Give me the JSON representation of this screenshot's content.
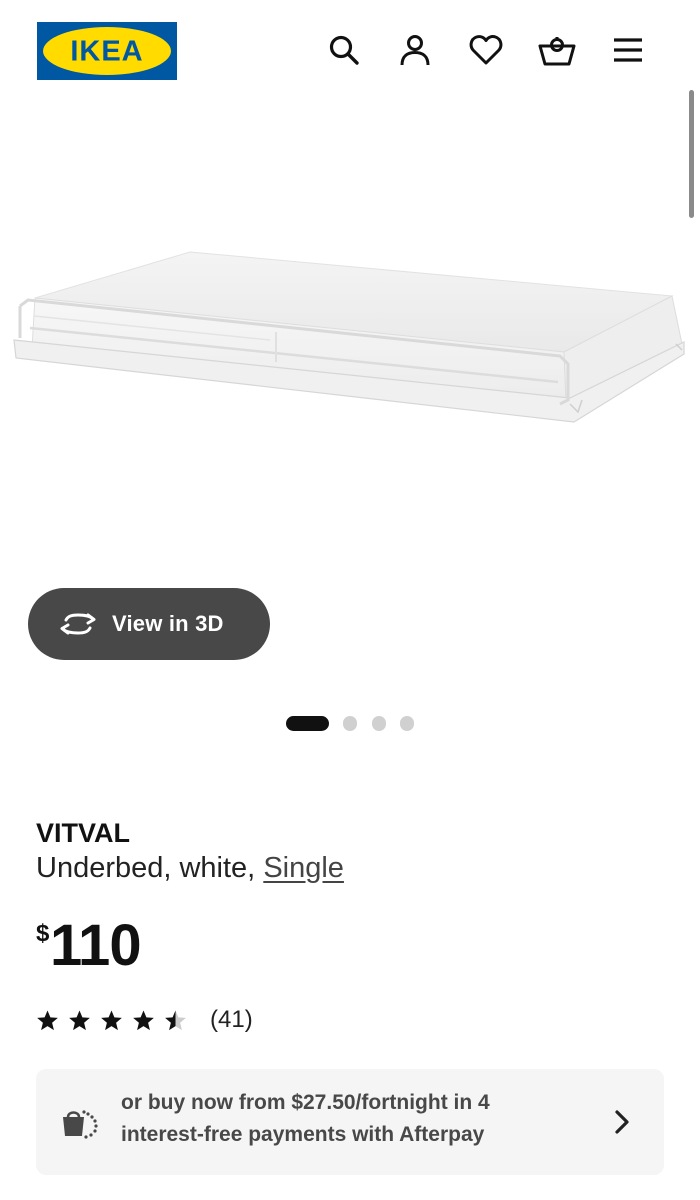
{
  "header": {
    "logo_text": "IKEA",
    "icons": [
      "search-icon",
      "account-icon",
      "heart-icon",
      "basket-icon",
      "menu-icon"
    ]
  },
  "gallery": {
    "view3d_label": "View in 3D",
    "active_slide": 1,
    "slide_count": 4
  },
  "product": {
    "name": "VITVAL",
    "description": "Underbed, white, ",
    "size_link": "Single",
    "price_currency": "$",
    "price_amount": "110",
    "rating_value": 4.5,
    "rating_max": 5,
    "review_count": "(41)"
  },
  "afterpay": {
    "text": "or buy now from $27.50/fortnight in 4 interest-free payments with Afterpay"
  },
  "colors": {
    "brand_blue": "#0058a3",
    "brand_yellow": "#ffdb00",
    "button_dark": "#484848",
    "panel_bg": "#f5f5f5"
  }
}
